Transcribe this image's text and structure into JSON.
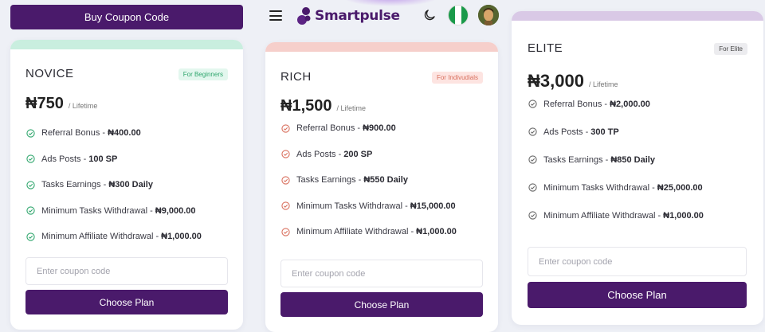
{
  "top_coupon_button": "Buy Coupon Code",
  "header": {
    "brand": "Smartpulse",
    "icons": [
      "menu-icon",
      "moon-icon",
      "nigeria-flag-icon",
      "avatar"
    ],
    "flag_colors": [
      "#1a9a4a",
      "#ffffff",
      "#1a9a4a"
    ]
  },
  "colors": {
    "primary": "#4a1a6b",
    "novice_band": "#c9eedf",
    "rich_band": "#f6cfcb",
    "elite_band": "#d9c9e6",
    "novice_check": "#2fa66d",
    "rich_check": "#d9705e",
    "elite_check": "#666666"
  },
  "plans": [
    {
      "name": "NOVICE",
      "badge": "For Beginners",
      "price": "₦750",
      "period": "/ Lifetime",
      "features": [
        {
          "label": "Referral Bonus -",
          "value": "₦400.00"
        },
        {
          "label": "Ads Posts -",
          "value": "100 SP"
        },
        {
          "label": "Tasks Earnings -",
          "value": "₦300 Daily"
        },
        {
          "label": "Minimum Tasks Withdrawal -",
          "value": "₦9,000.00"
        },
        {
          "label": "Minimum Affiliate Withdrawal -",
          "value": "₦1,000.00"
        }
      ],
      "coupon_placeholder": "Enter coupon code",
      "button": "Choose Plan"
    },
    {
      "name": "RICH",
      "badge": "For Indivudials",
      "price": "₦1,500",
      "period": "/ Lifetime",
      "features": [
        {
          "label": "Referral Bonus -",
          "value": "₦900.00"
        },
        {
          "label": "Ads Posts -",
          "value": "200 SP"
        },
        {
          "label": "Tasks Earnings -",
          "value": "₦550 Daily"
        },
        {
          "label": "Minimum Tasks Withdrawal -",
          "value": "₦15,000.00"
        },
        {
          "label": "Minimum Affiliate Withdrawal -",
          "value": "₦1,000.00"
        }
      ],
      "coupon_placeholder": "Enter coupon code",
      "button": "Choose Plan"
    },
    {
      "name": "ELITE",
      "badge": "For Elite",
      "price": "₦3,000",
      "period": "/ Lifetime",
      "features": [
        {
          "label": "Referral Bonus -",
          "value": "₦2,000.00"
        },
        {
          "label": "Ads Posts -",
          "value": "300 TP"
        },
        {
          "label": "Tasks Earnings -",
          "value": "₦850 Daily"
        },
        {
          "label": "Minimum Tasks Withdrawal -",
          "value": "₦25,000.00"
        },
        {
          "label": "Minimum Affiliate Withdrawal -",
          "value": "₦1,000.00"
        }
      ],
      "coupon_placeholder": "Enter coupon code",
      "button": "Choose Plan"
    }
  ]
}
